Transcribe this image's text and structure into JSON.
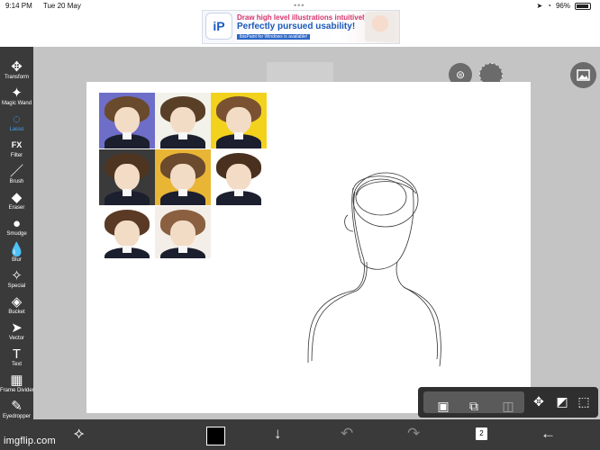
{
  "status_bar": {
    "time": "9:14 PM",
    "date": "Tue 20 May",
    "battery": "96%",
    "icons": [
      "wifi-icon",
      "battery-icon"
    ]
  },
  "ad": {
    "logo": "iP",
    "line1": "Draw high level illustrations intuitively!",
    "line2": "Perfectly pursued usability!",
    "line3": "ibisPaint for Windows is available!"
  },
  "toolbar": {
    "tools": [
      {
        "name": "transform",
        "label": "Transform",
        "icon": "✥"
      },
      {
        "name": "magic-wand",
        "label": "Magic Wand",
        "icon": "✦"
      },
      {
        "name": "lasso",
        "label": "Lasso",
        "icon": "◌",
        "active": true
      },
      {
        "name": "filter",
        "label": "Filter",
        "icon": "FX"
      },
      {
        "name": "brush",
        "label": "Brush",
        "icon": "／"
      },
      {
        "name": "eraser",
        "label": "Eraser",
        "icon": "◆"
      },
      {
        "name": "smudge",
        "label": "Smudge",
        "icon": "●"
      },
      {
        "name": "blur",
        "label": "Blur",
        "icon": "💧"
      },
      {
        "name": "special",
        "label": "Special",
        "icon": "✧"
      },
      {
        "name": "bucket",
        "label": "Bucket",
        "icon": "◈"
      },
      {
        "name": "vector",
        "label": "Vector",
        "icon": "➤"
      },
      {
        "name": "text",
        "label": "Text",
        "icon": "T"
      },
      {
        "name": "frame-divider",
        "label": "Frame Divider",
        "icon": "▦"
      },
      {
        "name": "eyedropper",
        "label": "Eyedropper",
        "icon": "✎"
      }
    ]
  },
  "bottom_bar": {
    "layers_count": "2",
    "watermark": "imgflip.com"
  },
  "colors": {
    "toolbar_bg": "#3a3a3a",
    "active_tool": "#4aa3ff",
    "workspace_bg": "#c4c4c4",
    "canvas_bg": "#ffffff",
    "brush_color": "#000000"
  },
  "reference_thumbnails": [
    {
      "bg": "#6e6ec8",
      "hair": "#6a4a2c"
    },
    {
      "bg": "#f2f2ea",
      "hair": "#5a3f27"
    },
    {
      "bg": "#f3d21e",
      "hair": "#7a5232"
    },
    {
      "bg": "#3a3a3a",
      "hair": "#4e3522"
    },
    {
      "bg": "#e9b535",
      "hair": "#6b4a2e"
    },
    {
      "bg": "#ffffff",
      "hair": "#4a311f"
    },
    {
      "bg": "#ffffff",
      "hair": "#5a3a24"
    },
    {
      "bg": "#f4eee8",
      "hair": "#8a6040"
    }
  ]
}
